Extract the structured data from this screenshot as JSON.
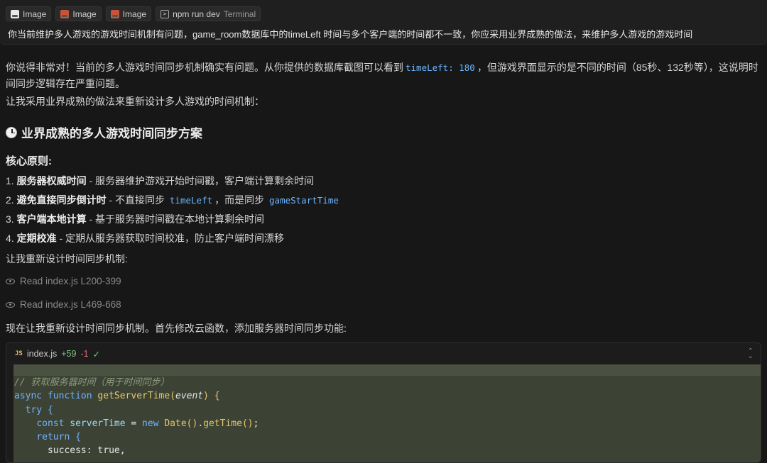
{
  "user_message": {
    "attachments": [
      {
        "icon": "image-icon",
        "label": "Image"
      },
      {
        "icon": "image-icon",
        "label": "Image"
      },
      {
        "icon": "image-icon",
        "label": "Image"
      },
      {
        "icon": "terminal-icon",
        "label": "npm run dev",
        "sublabel": "Terminal"
      }
    ],
    "text": "你当前维护多人游戏的游戏时间机制有问题，game_room数据库中的timeLeft 时间与多个客户端的时间都不一致，你应采用业界成熟的做法，来维护多人游戏的游戏时间"
  },
  "response": {
    "para1_a": "你说得非常对！当前的多人游戏时间同步机制确实有问题。从你提供的数据库截图可以看到",
    "para1_code": "timeLeft: 180",
    "para1_b": "，但游戏界面显示的是不同的时间（85秒、132秒等），这说明时间同步逻辑存在严重问题。",
    "para2": "让我采用业界成熟的做法来重新设计多人游戏的时间机制：",
    "heading": "业界成熟的多人游戏时间同步方案",
    "subheading": "核心原则:",
    "principles": [
      {
        "num": "1.",
        "bold": "服务器权威时间",
        "text": " - 服务器维护游戏开始时间戳，客户端计算剩余时间"
      },
      {
        "num": "2.",
        "bold": "避免直接同步倒计时",
        "text_a": " - 不直接同步 ",
        "code_a": "timeLeft",
        "text_b": "，而是同步 ",
        "code_b": "gameStartTime"
      },
      {
        "num": "3.",
        "bold": "客户端本地计算",
        "text": " - 基于服务器时间戳在本地计算剩余时间"
      },
      {
        "num": "4.",
        "bold": "定期校准",
        "text": " - 定期从服务器获取时间校准，防止客户端时间漂移"
      }
    ],
    "para3": "让我重新设计时间同步机制:",
    "reads": [
      {
        "file": "Read index.js L200-399"
      },
      {
        "file": "Read index.js L469-668"
      }
    ],
    "para4": "现在让我重新设计时间同步机制。首先修改云函数，添加服务器时间同步功能:"
  },
  "code_block": {
    "lang": "JS",
    "filename": "index.js",
    "additions": "+59",
    "deletions": "-1",
    "status": "✓",
    "lines": {
      "l1": "// 获取服务器时间（用于时间同步）",
      "l2_kw1": "async",
      "l2_kw2": "function",
      "l2_fn": "getServerTime",
      "l2_param": "event",
      "l3_kw": "try",
      "l4_kw": "const",
      "l4_var": "serverTime",
      "l4_new": "new",
      "l4_cls": "Date",
      "l4_fn": "getTime",
      "l5_kw": "return",
      "l6_key": "success",
      "l6_val": "true"
    }
  }
}
